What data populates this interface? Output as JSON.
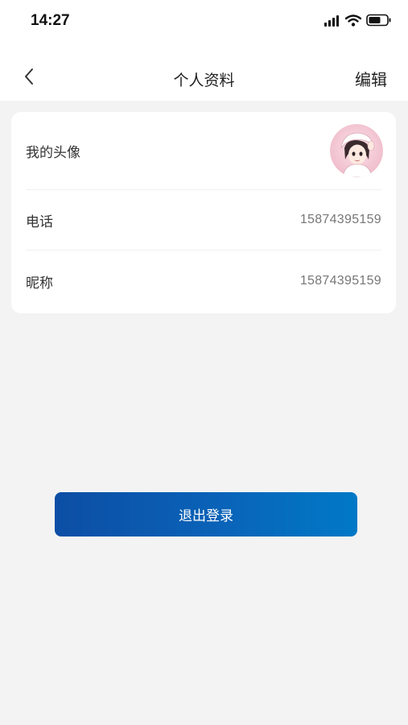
{
  "status_bar": {
    "time": "14:27",
    "icons": [
      "signal-icon",
      "wifi-icon",
      "battery-icon"
    ]
  },
  "nav": {
    "back_icon": "chevron-left-icon",
    "title": "个人资料",
    "edit_label": "编辑"
  },
  "profile": {
    "avatar_label": "我的头像",
    "phone_label": "电话",
    "phone_value": "15874395159",
    "nickname_label": "昵称",
    "nickname_value": "15874395159"
  },
  "actions": {
    "logout_label": "退出登录"
  },
  "colors": {
    "page_bg": "#f3f3f3",
    "card_bg": "#ffffff",
    "button_gradient_start": "#0c4ea5",
    "button_gradient_end": "#0079c6"
  }
}
